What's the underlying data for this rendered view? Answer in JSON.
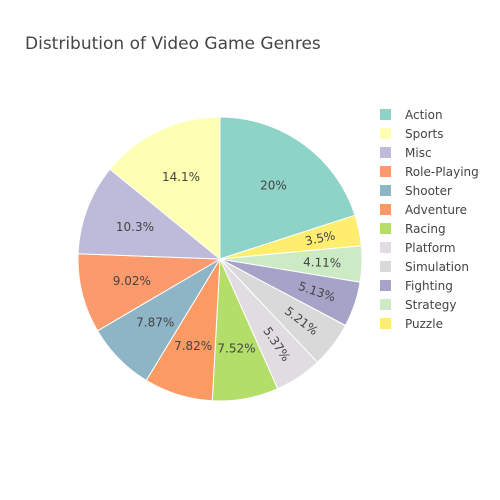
{
  "chart_data": {
    "type": "pie",
    "title": "Distribution of Video Game Genres",
    "legend_position": "right",
    "direction": "clockwise",
    "start": "12 o'clock",
    "slices": [
      {
        "label": "Action",
        "value": 20.0,
        "text": "20%",
        "color": "#8DD3C7"
      },
      {
        "label": "Puzzle",
        "value": 3.5,
        "text": "3.5%",
        "color": "#FFED6F"
      },
      {
        "label": "Strategy",
        "value": 4.11,
        "text": "4.11%",
        "color": "#CCEBC5"
      },
      {
        "label": "Fighting",
        "value": 5.13,
        "text": "5.13%",
        "color": "#A6A3C8"
      },
      {
        "label": "Simulation",
        "value": 5.21,
        "text": "5.21%",
        "color": "#D9D9D9"
      },
      {
        "label": "Platform",
        "value": 5.37,
        "text": "5.37%",
        "color": "#E1DCE1"
      },
      {
        "label": "Racing",
        "value": 7.52,
        "text": "7.52%",
        "color": "#B3DE69"
      },
      {
        "label": "Adventure",
        "value": 7.82,
        "text": "7.82%",
        "color": "#FB9A62"
      },
      {
        "label": "Shooter",
        "value": 7.87,
        "text": "7.87%",
        "color": "#8EB5C6"
      },
      {
        "label": "Role-Playing",
        "value": 9.02,
        "text": "9.02%",
        "color": "#FB9A6C"
      },
      {
        "label": "Misc",
        "value": 10.3,
        "text": "10.3%",
        "color": "#BEBADA"
      },
      {
        "label": "Sports",
        "value": 14.1,
        "text": "14.1%",
        "color": "#FFFFB3"
      }
    ],
    "legend_order": [
      "Action",
      "Sports",
      "Misc",
      "Role-Playing",
      "Shooter",
      "Adventure",
      "Racing",
      "Platform",
      "Simulation",
      "Fighting",
      "Strategy",
      "Puzzle"
    ]
  }
}
